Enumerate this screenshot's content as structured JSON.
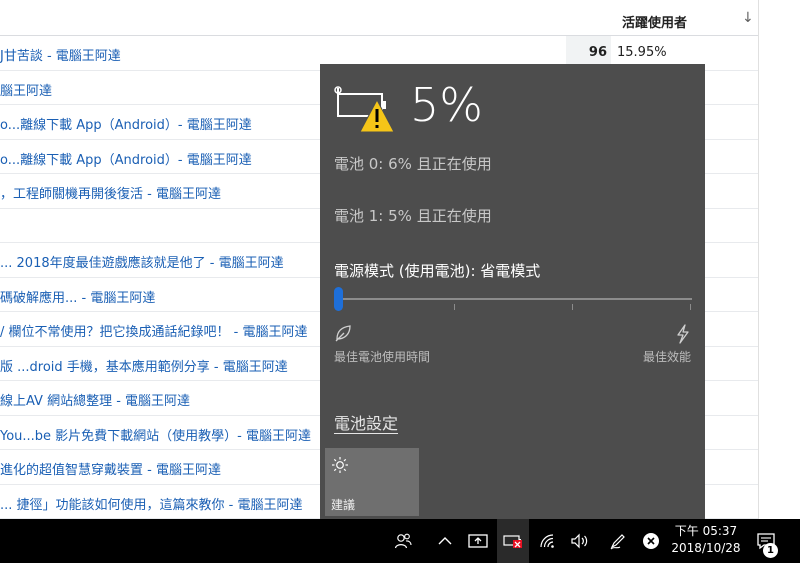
{
  "table": {
    "column_active_users": "活躍使用者",
    "sort_arrow": "↓",
    "rows": [
      {
        "title": "J甘苦談 - 電腦王阿達",
        "count": "96",
        "pct": "15.95%"
      },
      {
        "title": "腦王阿達"
      },
      {
        "title": "o...離線下載 App（Android）- 電腦王阿達"
      },
      {
        "title": "o...離線下載 App（Android）- 電腦王阿達"
      },
      {
        "title": "，工程師關機再開後復活 - 電腦王阿達"
      },
      {
        "title": ""
      },
      {
        "title": "... 2018年度最佳遊戲應該就是他了 - 電腦王阿達"
      },
      {
        "title": "碼破解應用... - 電腦王阿達"
      },
      {
        "title": "/ 欄位不常使用？把它換成通話紀錄吧！ - 電腦王阿達"
      },
      {
        "title": "版 ...droid 手機，基本應用範例分享 - 電腦王阿達"
      },
      {
        "title": "線上AV 網站總整理 - 電腦王阿達"
      },
      {
        "title": "You...be 影片免費下載網站（使用教學）- 電腦王阿達"
      },
      {
        "title": "進化的超值智慧穿戴裝置 - 電腦王阿達"
      },
      {
        "title": "... 捷徑」功能該如何使用，這篇來教你 - 電腦王阿達"
      }
    ]
  },
  "flyout": {
    "percent": "5%",
    "battery0": "電池 0: 6% 且正在使用",
    "battery1": "電池 1: 5% 且正在使用",
    "power_mode": "電源模式 (使用電池): 省電模式",
    "slider_level": 0,
    "best_battery_life": "最佳電池使用時間",
    "best_performance": "最佳效能",
    "battery_settings": "電池設定",
    "suggestion_tile": "建議",
    "accent_color": "#1e6fd9",
    "warning_color": "#f5c518"
  },
  "taskbar": {
    "time": "下午 05:37",
    "date": "2018/10/28",
    "notification_count": "1",
    "icons": [
      "people-icon",
      "chevron-up-icon",
      "screen-capture-icon",
      "battery-warning-icon",
      "wifi-icon",
      "volume-icon",
      "pen-icon",
      "close-circle-icon",
      "action-center-icon"
    ]
  }
}
